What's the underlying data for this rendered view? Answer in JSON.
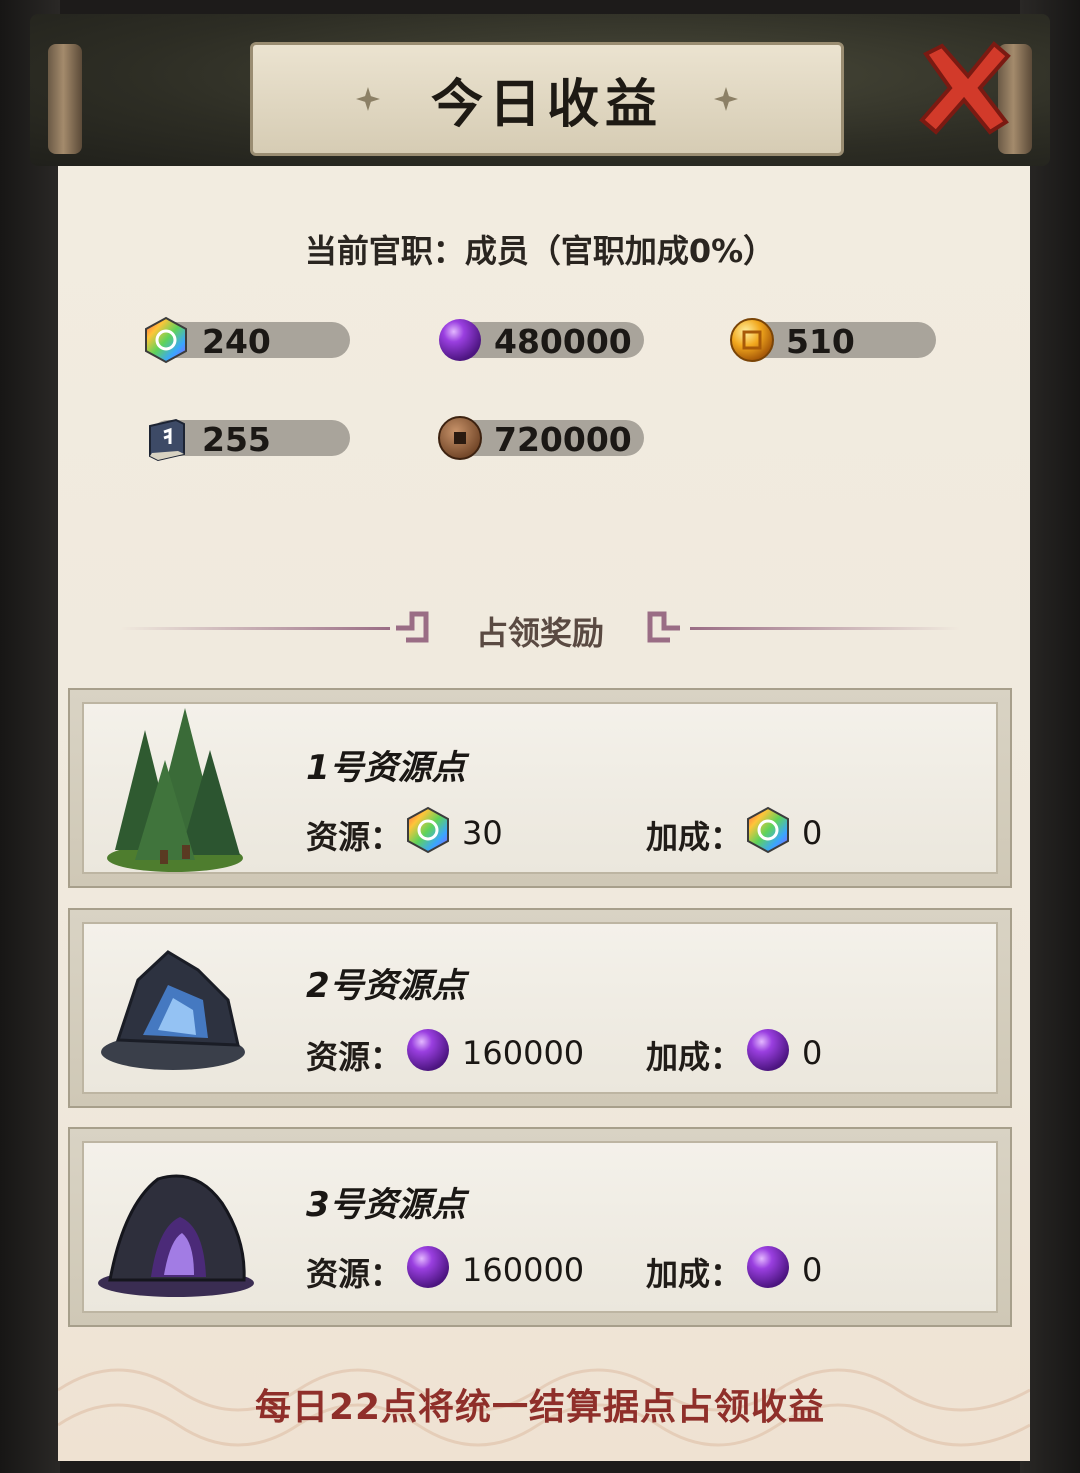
{
  "title": "今日收益",
  "rank_line": "当前官职：成员（官职加成0%）",
  "resources": [
    {
      "icon": "rainbow-gem-icon",
      "value": "240"
    },
    {
      "icon": "purple-orb-icon",
      "value": "480000"
    },
    {
      "icon": "gold-coin-icon",
      "value": "510"
    },
    {
      "icon": "book-icon",
      "value": "255"
    },
    {
      "icon": "copper-coin-icon",
      "value": "720000"
    }
  ],
  "section_title": "占领奖励",
  "points": [
    {
      "name": "1号资源点",
      "image": "forest-icon",
      "resource_label": "资源：",
      "resource_icon": "rainbow-gem-icon",
      "resource_value": "30",
      "bonus_label": "加成：",
      "bonus_icon": "rainbow-gem-icon",
      "bonus_value": "0"
    },
    {
      "name": "2号资源点",
      "image": "crystal-rock-icon",
      "resource_label": "资源：",
      "resource_icon": "purple-orb-icon",
      "resource_value": "160000",
      "bonus_label": "加成：",
      "bonus_icon": "purple-orb-icon",
      "bonus_value": "0"
    },
    {
      "name": "3号资源点",
      "image": "cave-icon",
      "resource_label": "资源：",
      "resource_icon": "purple-orb-icon",
      "resource_value": "160000",
      "bonus_label": "加成：",
      "bonus_icon": "purple-orb-icon",
      "bonus_value": "0"
    }
  ],
  "footer_note": "每日22点将统一结算据点占领收益",
  "colors": {
    "footer": "#8f2f2a",
    "close": "#d23a2a",
    "purple": "#7b2fc0"
  }
}
